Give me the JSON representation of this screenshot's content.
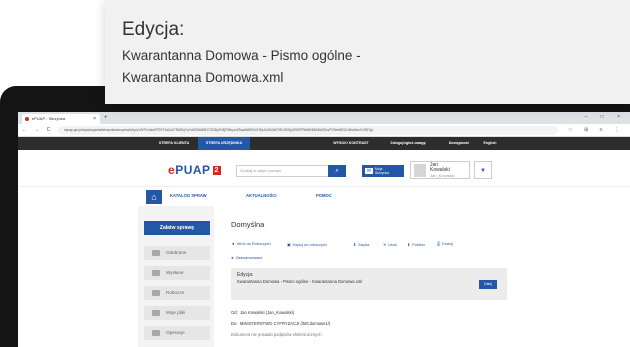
{
  "browser": {
    "tab_title": "ePUAP - Skrzynka",
    "tab_close": "×",
    "new_tab": "+",
    "window_controls": "–  □  ×",
    "nav_icons": "←  →  C  ⌂",
    "url": "epuap.gov.pl/wps/myportal/skrzynka/skrzynka/!ut/p/z1/lVPLUtswFP2VTJdZuZYDMEvjYoVnEOM4B3iYC2D5yZH3jF3Bq-ec8TaadN0fOXnTWcJU4K0AtTVEv3SGpGROPP5dW0M0N0d2SzvPVSmWR12vI5sb5xc7vVfD7gI",
    "extra_icons": "☆  ⊞  ≡  ⋮"
  },
  "topbar": {
    "strefa_klienta": "STREFA KLIENTA",
    "strefa_urzednika": "STREFA URZĘDNIKA",
    "wysoki_kontrast": "WYSOKI KONTRAST",
    "zglos_uwage": "Zaloguj/zgłoś uwagę",
    "dostepnosc": "Dostępność",
    "english": "English"
  },
  "header": {
    "logo_prefix": "e",
    "logo_main": "PUAP",
    "logo_suffix": "2",
    "search_placeholder": "Szukaj w całym portalu",
    "search_icon": "⌕",
    "mailbox_line1": "Moja",
    "mailbox_line2": "Skrzynka",
    "mailbox_icon": "✉",
    "user_first": "Jan",
    "user_last": "Kowalski",
    "user_login": "Jan_Kowalski",
    "user_caret": "▼"
  },
  "nav": {
    "home_icon": "⌂",
    "katalog": "KATALOG SPRAW",
    "aktualnosci": "AKTUALNOŚCI",
    "pomoc": "POMOC"
  },
  "sidebar": {
    "new_case": "Załatw sprawę",
    "items": [
      {
        "label": "Odebrane"
      },
      {
        "label": "Wysłane"
      },
      {
        "label": "Robocze"
      },
      {
        "label": "Moje pliki"
      },
      {
        "label": "Operacje"
      }
    ]
  },
  "main": {
    "page_title": "Domyślna",
    "actions": [
      {
        "label": "Wróć do Roboczych",
        "icon": "◄"
      },
      {
        "label": "Kopiuj do roboczych",
        "icon": "▣"
      },
      {
        "label": "Zapisz",
        "icon": "⬇"
      },
      {
        "label": "Usuń",
        "icon": "✕"
      },
      {
        "label": "Pobierz",
        "icon": "⬇"
      },
      {
        "label": "Drukuj",
        "icon": "⎙"
      }
    ],
    "zaawansowane": "► Zaawansowane",
    "msg_title": "Edycja:",
    "msg_subtitle": "Kwarantanna Domowa - Pismo ogólne - Kwarantanna Domowa.xml",
    "msg_button": "Dalej",
    "od_label": "Od:",
    "od_value": "Jan Kowalski (Jan_Kowalski)",
    "do_label": "Do:",
    "do_value": "MINISTERSTWO CYFRYZACJI (/MCdomowe1/)",
    "doc_status": "Dokument nie posiada podpisów elektronicznych"
  },
  "popup": {
    "title": "Edycja:",
    "subtitle": "Kwarantanna Domowa - Pismo ogólne - Kwarantanna Domowa.xml"
  }
}
